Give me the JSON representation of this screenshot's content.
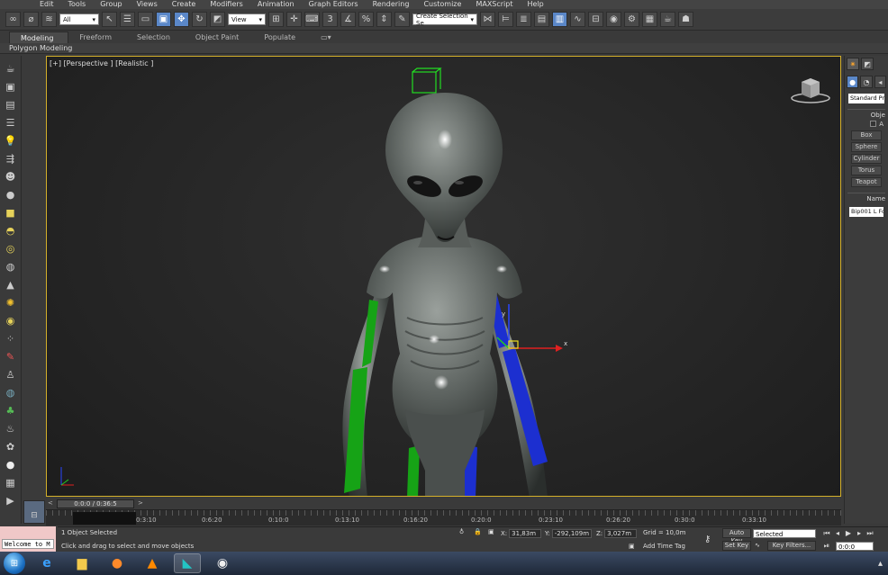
{
  "menu": [
    "Edit",
    "Tools",
    "Group",
    "Views",
    "Create",
    "Modifiers",
    "Animation",
    "Graph Editors",
    "Rendering",
    "Customize",
    "MAXScript",
    "Help"
  ],
  "toolbar": {
    "filter_value": "All",
    "refcoord_value": "View",
    "named_selection_value": "Create Selection Se",
    "snap_label": "3",
    "angle_snap_label": "n"
  },
  "ribbon": {
    "tabs": [
      "Modeling",
      "Freeform",
      "Selection",
      "Object Paint",
      "Populate"
    ],
    "active_tab": "Modeling",
    "sub_label": "Polygon Modeling"
  },
  "viewport": {
    "label": "[+] [Perspective ] [Realistic ]",
    "gizmo_x": "x",
    "gizmo_y": "y"
  },
  "command_panel": {
    "category_value": "Standard Prim",
    "rollout_object_type": "Obje",
    "autogrid": "A",
    "buttons": [
      "Box",
      "Sphere",
      "Cylinder",
      "Torus",
      "Teapot"
    ],
    "rollout_name": "Name",
    "name_value": "Bip001 L Fore"
  },
  "timeline": {
    "thumb": "0:0:0 / 0:36:5",
    "ticks": [
      "0:3:10",
      "0:6:20",
      "0:10:0",
      "0:13:10",
      "0:16:20",
      "0:20:0",
      "0:23:10",
      "0:26:20",
      "0:30:0",
      "0:33:10"
    ]
  },
  "status": {
    "selection": "1 Object Selected",
    "prompt": "Click and drag to select and move objects",
    "welcome": "Welcome to M",
    "x_label": "X:",
    "x_value": "31,83m",
    "y_label": "Y:",
    "y_value": "-292,109m",
    "z_label": "Z:",
    "z_value": "3,027m",
    "grid": "Grid = 10,0m",
    "add_time_tag": "Add Time Tag",
    "auto_key": "Auto Key",
    "set_key": "Set Key",
    "key_mode_value": "Selected",
    "key_filters": "Key Filters...",
    "frame_value": "0:0:0"
  },
  "colors": {
    "accent_blue": "#5a87c8",
    "viewport_border": "#d4b02a",
    "bone_green": "#16a316",
    "bone_blue": "#1c2fd0"
  }
}
